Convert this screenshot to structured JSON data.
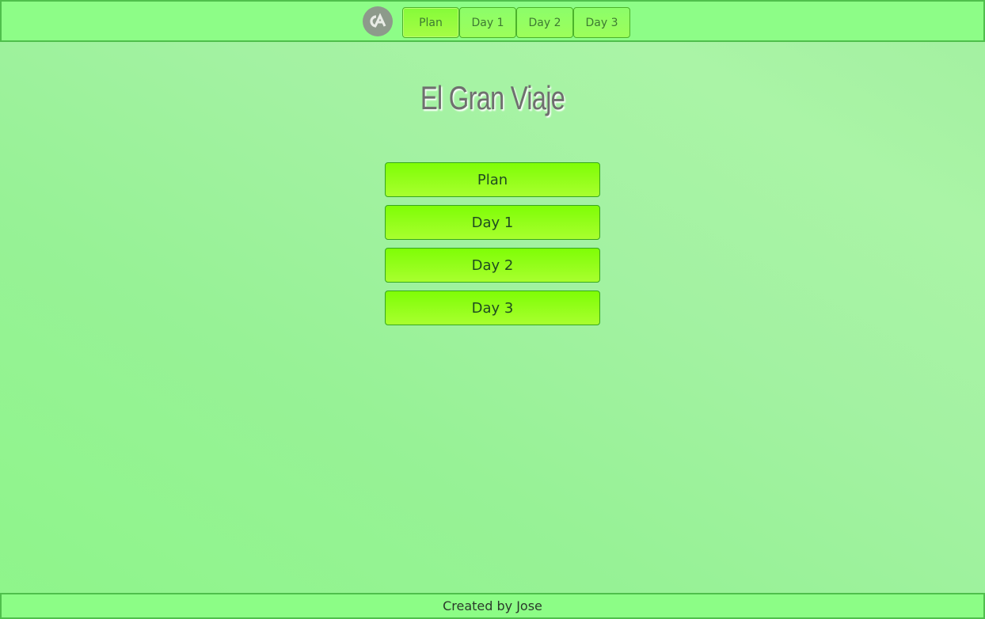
{
  "nav": {
    "logo_icon": "ca-logo-icon",
    "items": [
      {
        "label": "Plan"
      },
      {
        "label": "Day 1"
      },
      {
        "label": "Day 2"
      },
      {
        "label": "Day 3"
      }
    ]
  },
  "page": {
    "title": "El Gran Viaje"
  },
  "menu": {
    "buttons": [
      {
        "label": "Plan"
      },
      {
        "label": "Day 1"
      },
      {
        "label": "Day 2"
      },
      {
        "label": "Day 3"
      }
    ]
  },
  "footer": {
    "text": "Created by Jose"
  },
  "colors": {
    "nav_bar": "#8dfd87",
    "button_green": "#8dfe1a",
    "title_gray": "#6f6f6f"
  }
}
